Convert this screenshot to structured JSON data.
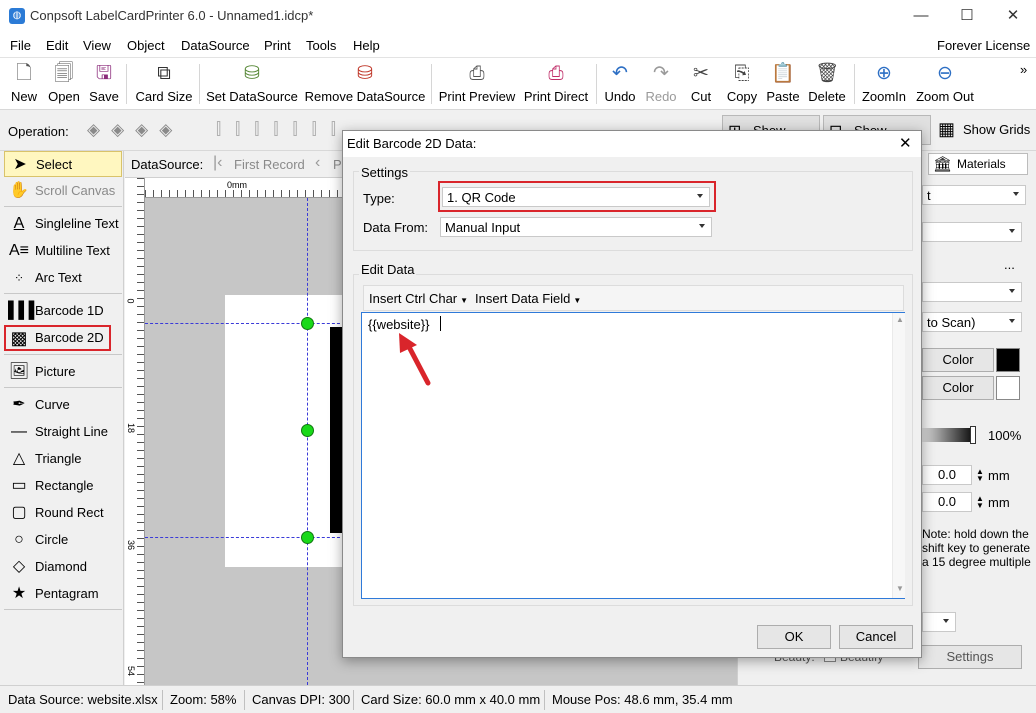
{
  "window": {
    "title": "Conpsoft LabelCardPrinter 6.0 - Unnamed1.idcp*",
    "minimize_glyph": "—",
    "maximize_glyph": "☐",
    "close_glyph": "✕"
  },
  "menu": {
    "items": [
      "File",
      "Edit",
      "View",
      "Object",
      "DataSource",
      "Print",
      "Tools",
      "Help"
    ],
    "license": "Forever License"
  },
  "toolbar": {
    "new": "New",
    "open": "Open",
    "save": "Save",
    "card_size": "Card Size",
    "set_datasource": "Set DataSource",
    "remove_datasource": "Remove DataSource",
    "print_preview": "Print Preview",
    "print_direct": "Print Direct",
    "undo": "Undo",
    "redo": "Redo",
    "cut": "Cut",
    "copy": "Copy",
    "paste": "Paste",
    "delete": "Delete",
    "zoom_in": "ZoomIn",
    "zoom_out": "Zoom Out",
    "overflow": "»"
  },
  "operation": {
    "label": "Operation:",
    "show_ruler": "Show Ruler",
    "show_guides": "Show Guides",
    "show_grids": "Show Grids"
  },
  "tools": {
    "select": "Select",
    "scroll_canvas": "Scroll Canvas",
    "singleline_text": "Singleline Text",
    "multiline_text": "Multiline Text",
    "arc_text": "Arc Text",
    "barcode_1d": "Barcode 1D",
    "barcode_2d": "Barcode 2D",
    "picture": "Picture",
    "curve": "Curve",
    "straight_line": "Straight Line",
    "triangle": "Triangle",
    "rectangle": "Rectangle",
    "round_rect": "Round Rect",
    "circle": "Circle",
    "diamond": "Diamond",
    "pentagram": "Pentagram"
  },
  "canvas": {
    "datasource_label": "DataSource:",
    "first_record": "First Record",
    "prev_record": "P",
    "ruler_zero": "0mm",
    "ruler_v_marks": [
      "0",
      "18",
      "36",
      "54"
    ]
  },
  "right_panel": {
    "materials_tab": "Materials",
    "type_value_partial": "t",
    "scan_partial": "to Scan)",
    "color1": "Color",
    "color2": "Color",
    "opacity": "100%",
    "spin1": "0.0",
    "spin2": "0.0",
    "unit": "mm",
    "note": "Note: hold down the shift key to generate a 15 degree multiple",
    "beauty_label": "Beauty:",
    "beautify": "Beautify",
    "settings": "Settings",
    "dots": "..."
  },
  "dialog": {
    "title": "Edit Barcode 2D Data:",
    "close_glyph": "✕",
    "settings_label": "Settings",
    "type_label": "Type:",
    "type_value": "1.  QR Code",
    "data_from_label": "Data From:",
    "data_from_value": "Manual Input",
    "edit_data_label": "Edit Data",
    "insert_ctrl_char": "Insert Ctrl Char",
    "insert_data_field": "Insert Data Field",
    "data_text": "{{website}}",
    "ok": "OK",
    "cancel": "Cancel"
  },
  "status": {
    "data_source": "Data Source: website.xlsx",
    "zoom": "Zoom: 58%",
    "canvas_dpi": "Canvas DPI: 300",
    "card_size": "Card Size: 60.0 mm x 40.0 mm",
    "mouse_pos": "Mouse Pos: 48.6 mm, 35.4 mm"
  },
  "colors": {
    "highlight_red": "#d9252b",
    "guide_blue": "#3a3ad8",
    "handle_green": "#19d919",
    "selected_tool_bg": "#fff7c0",
    "undo_blue": "#2d6fc4"
  }
}
